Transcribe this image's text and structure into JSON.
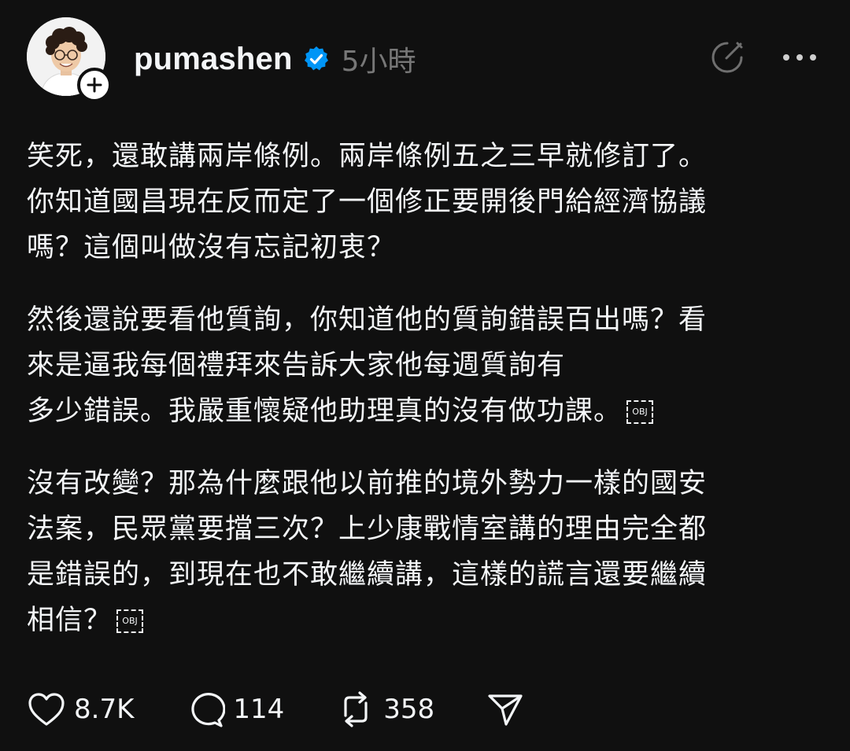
{
  "post": {
    "username": "pumashen",
    "time": "5小時",
    "paragraphs": [
      {
        "text": "笑死，還敢講兩岸條例。兩岸條例五之三早就修訂了。\n你知道國昌現在反而定了一個修正要開後門給經濟協議\n嗎？這個叫做沒有忘記初衷？",
        "obj": ""
      },
      {
        "text": "然後還說要看他質詢，你知道他的質詢錯誤百出嗎？看\n來是逼我每個禮拜來告訴大家他每週質詢有\n多少錯誤。我嚴重懷疑他助理真的沒有做功課。",
        "obj": "OBJ"
      },
      {
        "text": "沒有改變？那為什麼跟他以前推的境外勢力一樣的國安\n法案，民眾黨要擋三次？上少康戰情室講的理由完全都\n是錯誤的，到現在也不敢繼續講，這樣的謊言還要繼續\n相信？",
        "obj": "OBJ"
      }
    ]
  },
  "stats": {
    "likes": "8.7K",
    "replies": "114",
    "reposts": "358"
  },
  "icons": {
    "verified": "verified-badge-icon",
    "follow": "plus-icon",
    "translate": "translate-icon",
    "more": "more-horizontal-icon",
    "like": "heart-icon",
    "reply": "comment-icon",
    "repost": "repost-icon",
    "share": "send-icon"
  },
  "colors": {
    "background": "#101010",
    "text": "#f3f5f7",
    "muted": "#777777",
    "verified": "#0095f6"
  }
}
